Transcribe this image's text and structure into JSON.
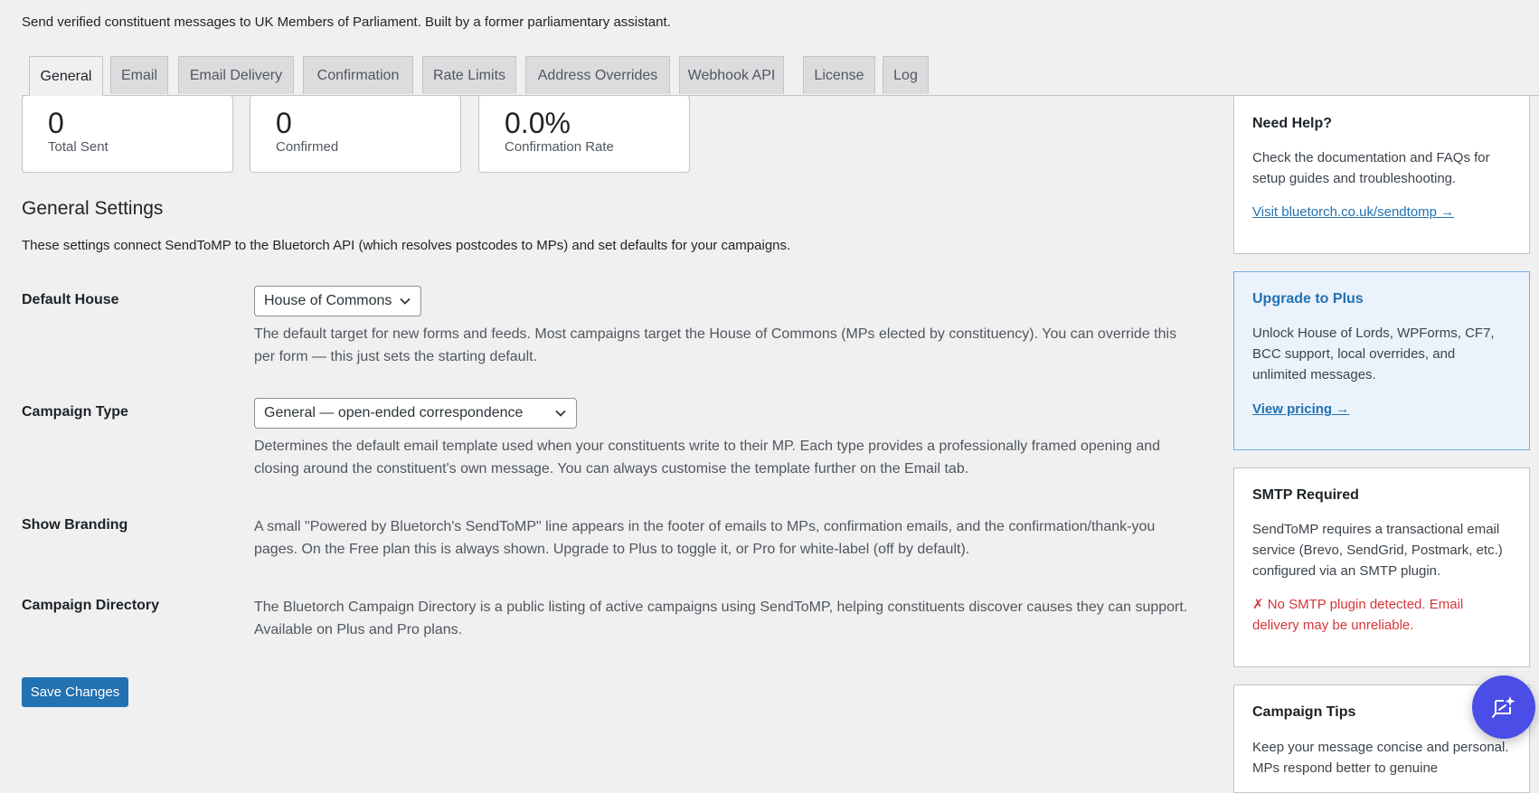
{
  "intro": "Send verified constituent messages to UK Members of Parliament. Built by a former parliamentary assistant.",
  "tabs": [
    "General",
    "Email",
    "Email Delivery",
    "Confirmation",
    "Rate Limits",
    "Address Overrides",
    "Webhook API",
    "License",
    "Log"
  ],
  "active_tab": "General",
  "stats": [
    {
      "value": "0",
      "label": "Total Sent"
    },
    {
      "value": "0",
      "label": "Confirmed"
    },
    {
      "value": "0.0%",
      "label": "Confirmation Rate"
    }
  ],
  "settings": {
    "title": "General Settings",
    "description": "These settings connect SendToMP to the Bluetorch API (which resolves postcodes to MPs) and set defaults for your campaigns.",
    "default_house": {
      "label": "Default House",
      "value": "House of Commons",
      "help": "The default target for new forms and feeds. Most campaigns target the House of Commons (MPs elected by constituency). You can override this per form — this just sets the starting default."
    },
    "campaign_type": {
      "label": "Campaign Type",
      "value": "General — open-ended correspondence",
      "help": "Determines the default email template used when your constituents write to their MP. Each type provides a professionally framed opening and closing around the constituent's own message. You can always customise the template further on the Email tab."
    },
    "show_branding": {
      "label": "Show Branding",
      "help": "A small \"Powered by Bluetorch's SendToMP\" line appears in the footer of emails to MPs, confirmation emails, and the confirmation/thank-you pages. On the Free plan this is always shown. Upgrade to Plus to toggle it, or Pro for white-label (off by default)."
    },
    "campaign_directory": {
      "label": "Campaign Directory",
      "help": "The Bluetorch Campaign Directory is a public listing of active campaigns using SendToMP, helping constituents discover causes they can support. Available on Plus and Pro plans."
    },
    "save_label": "Save Changes"
  },
  "sidebar": {
    "help": {
      "title": "Need Help?",
      "text": "Check the documentation and FAQs for setup guides and troubleshooting.",
      "link": "Visit bluetorch.co.uk/sendtomp →"
    },
    "upgrade": {
      "title": "Upgrade to Plus",
      "text": "Unlock House of Lords, WPForms, CF7, BCC support, local overrides, and unlimited messages.",
      "link": "View pricing →"
    },
    "smtp": {
      "title": "SMTP Required",
      "text": "SendToMP requires a transactional email service (Brevo, SendGrid, Postmark, etc.) configured via an SMTP plugin.",
      "error": "✗ No SMTP plugin detected. Email delivery may be unreliable."
    },
    "tips": {
      "title": "Campaign Tips",
      "text": "Keep your message concise and personal. MPs respond better to genuine"
    }
  },
  "colors": {
    "primary": "#2271b1",
    "error": "#d63638",
    "fab": "#4a4ee6"
  },
  "icons": {
    "fab": "chat-sparkle-icon",
    "select": "chevron-down-icon"
  }
}
